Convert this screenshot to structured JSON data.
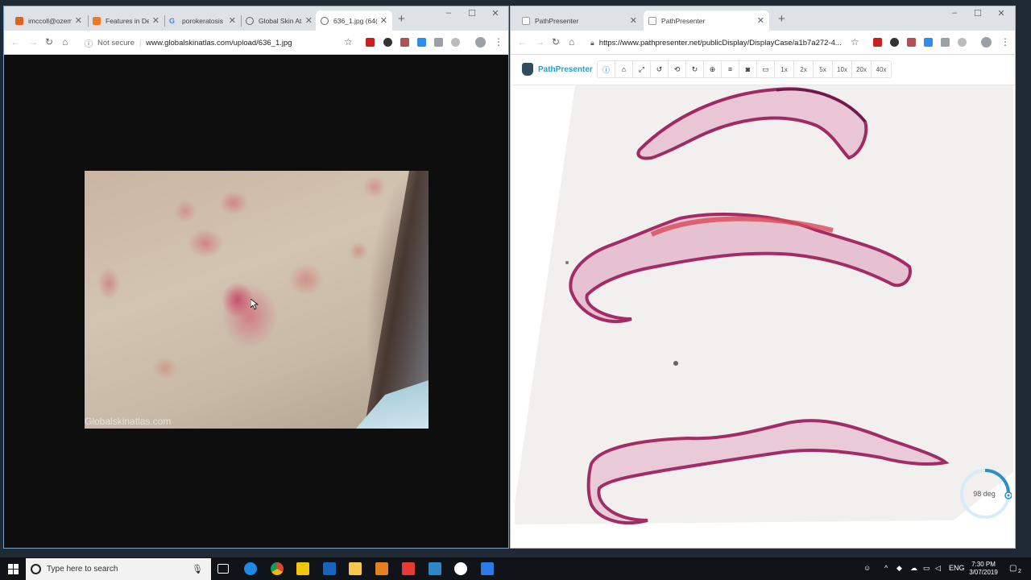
{
  "left_window": {
    "tabs": [
      {
        "title": "imccoll@ozem",
        "favicon_color": "#e2611d"
      },
      {
        "title": "Features in De",
        "favicon_color": "#f4781e"
      },
      {
        "title": "porokeratosis",
        "favicon_color": "#4285f4"
      },
      {
        "title": "Global Skin At",
        "favicon_color": "#5f6368"
      },
      {
        "title": "636_1.jpg (64(",
        "favicon_color": "#5f6368",
        "active": true
      }
    ],
    "security_label": "Not secure",
    "url": "www.globalskinatlas.com/upload/636_1.jpg",
    "image_watermark": "Globalskinatlas.com"
  },
  "right_window": {
    "tabs": [
      {
        "title": "PathPresenter",
        "favicon_color": "#9aa0a6"
      },
      {
        "title": "PathPresenter",
        "favicon_color": "#9aa0a6",
        "active": true
      }
    ],
    "url": "https://www.pathpresenter.net/publicDisplay/DisplayCase/a1b7a272-4...",
    "app_name": "PathPresenter",
    "tool_icons": [
      "info-icon",
      "home-icon",
      "fullscreen-icon",
      "rotate-left-icon",
      "rotate-icon",
      "rotate-right-icon",
      "zoom-in-icon",
      "settings-icon",
      "camera-icon",
      "monitor-icon"
    ],
    "magnifications": [
      "1x",
      "2x",
      "5x",
      "10x",
      "20x",
      "40x"
    ],
    "rotation_label": "98 deg",
    "rotation_fraction": 0.27
  },
  "taskbar": {
    "search_placeholder": "Type here to search",
    "language": "ENG",
    "time": "7:30 PM",
    "date": "3/07/2019",
    "notification_count": "2"
  }
}
